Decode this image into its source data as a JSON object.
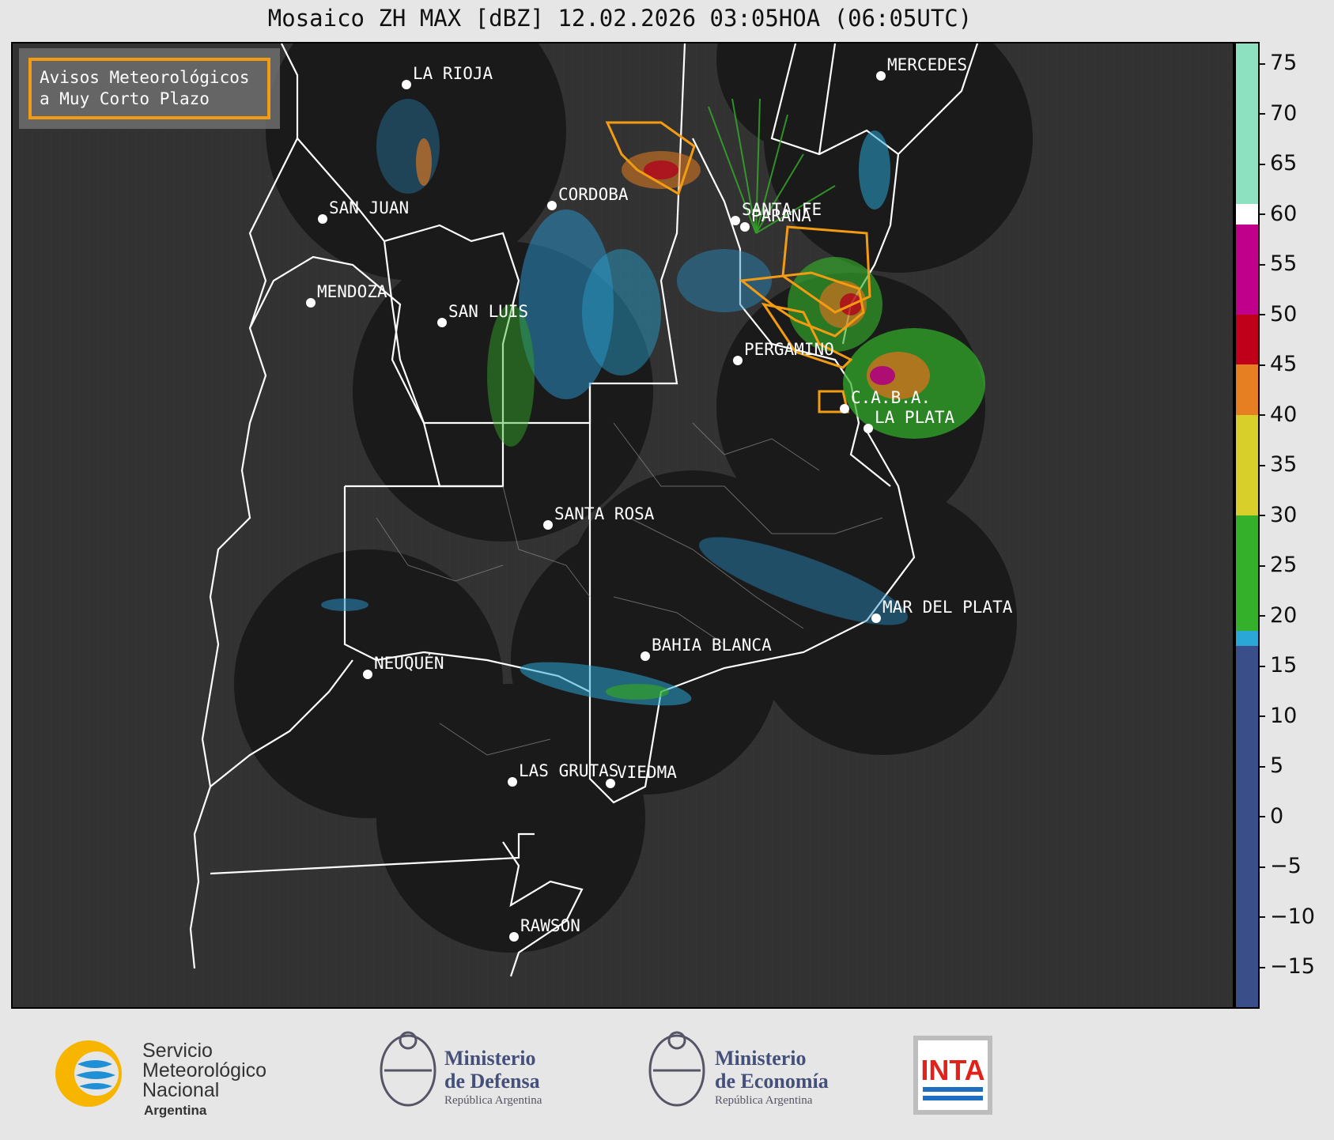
{
  "title": "Mosaico ZH MAX [dBZ] 12.02.2026 03:05HOA (06:05UTC)",
  "legend": {
    "line1": "Avisos Meteorológicos",
    "line2": "a Muy Corto Plazo",
    "color": "#f39c12"
  },
  "cities": [
    {
      "name": "LA RIOJA"
    },
    {
      "name": "MERCEDES"
    },
    {
      "name": "CORDOBA"
    },
    {
      "name": "SAN JUAN"
    },
    {
      "name": "SANTA FE"
    },
    {
      "name": "PARANA"
    },
    {
      "name": "MENDOZA"
    },
    {
      "name": "SAN LUIS"
    },
    {
      "name": "PERGAMINO"
    },
    {
      "name": "C.A.B.A."
    },
    {
      "name": "LA PLATA"
    },
    {
      "name": "SANTA ROSA"
    },
    {
      "name": "MAR DEL PLATA"
    },
    {
      "name": "BAHIA BLANCA"
    },
    {
      "name": "NEUQUÉN"
    },
    {
      "name": "LAS GRUTAS"
    },
    {
      "name": "VIEDMA"
    },
    {
      "name": "RAWSON"
    }
  ],
  "colorbar": {
    "unit": "dBZ",
    "min": -19,
    "max": 77,
    "ticks": [
      "75",
      "70",
      "65",
      "60",
      "55",
      "50",
      "45",
      "40",
      "35",
      "30",
      "25",
      "20",
      "15",
      "10",
      "5",
      "0",
      "−5",
      "−10",
      "−15"
    ],
    "tick_values": [
      75,
      70,
      65,
      60,
      55,
      50,
      45,
      40,
      35,
      30,
      25,
      20,
      15,
      10,
      5,
      0,
      -5,
      -10,
      -15
    ],
    "bands": [
      {
        "from": -19,
        "to": 17,
        "color": "#3a4f8a"
      },
      {
        "from": 17,
        "to": 18.5,
        "color": "#2aa7d6"
      },
      {
        "from": 18.5,
        "to": 30,
        "color": "#35b02a"
      },
      {
        "from": 30,
        "to": 40,
        "color": "#d8cf2a"
      },
      {
        "from": 40,
        "to": 45,
        "color": "#e67e22"
      },
      {
        "from": 45,
        "to": 50,
        "color": "#c0001a"
      },
      {
        "from": 50,
        "to": 59,
        "color": "#c0008a"
      },
      {
        "from": 59,
        "to": 61,
        "color": "#ffffff"
      },
      {
        "from": 61,
        "to": 77,
        "color": "#8de0c0"
      }
    ]
  },
  "logos": {
    "smn": {
      "line1": "Servicio",
      "line2": "Meteorológico",
      "line3": "Nacional",
      "line4": "Argentina"
    },
    "defensa": {
      "line1": "Ministerio",
      "line2": "de Defensa",
      "line3": "República Argentina"
    },
    "economia": {
      "line1": "Ministerio",
      "line2": "de Economía",
      "line3": "República Argentina"
    },
    "inta": {
      "label": "INTA"
    }
  }
}
